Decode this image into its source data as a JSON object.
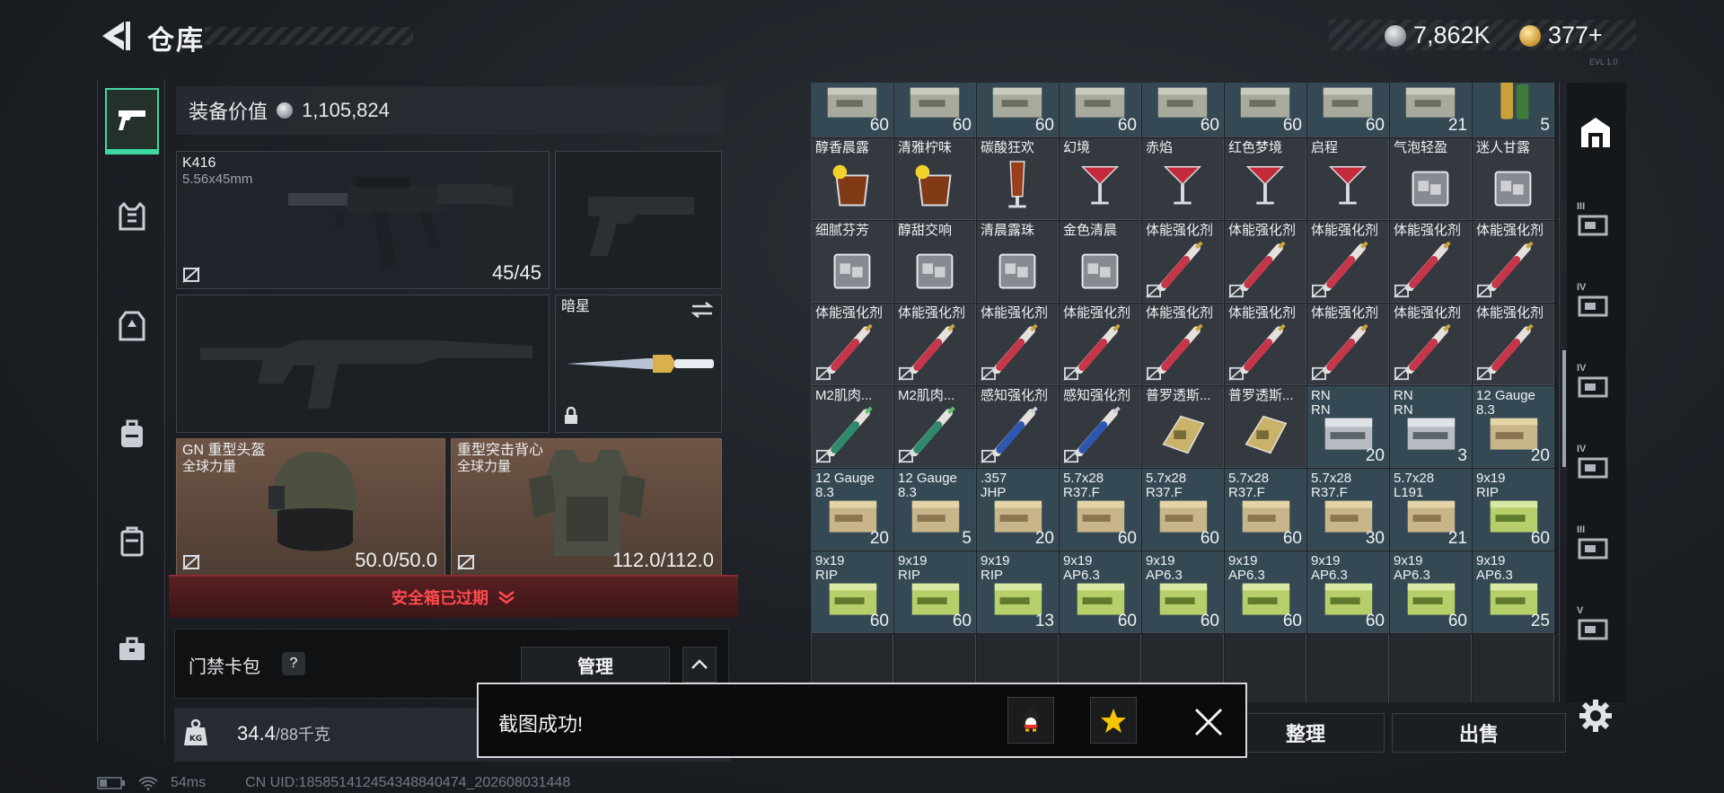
{
  "header": {
    "title": "仓库",
    "silver": "7,862K",
    "gold": "377+",
    "version": "EVL 1.0"
  },
  "loadout": {
    "equip_value_label": "装备价值",
    "equip_value": "1,105,824",
    "primary": {
      "name": "K416",
      "caliber": "5.56x45mm",
      "ammo": "45/45"
    },
    "melee": {
      "name": "暗星"
    },
    "helmet": {
      "name": "GN 重型头盔",
      "tag": "全球力量",
      "durability": "50.0/50.0"
    },
    "armor": {
      "name": "重型突击背心",
      "tag": "全球力量",
      "durability": "112.0/112.0"
    },
    "safe_box": "安全箱已过期",
    "keycard_label": "门禁卡包",
    "help": "?",
    "manage": "管理",
    "weight": "34.4",
    "weight_max": "/88千克"
  },
  "inventory": {
    "rows": [
      [
        {
          "type": "ammo-box",
          "qty": "60"
        },
        {
          "type": "ammo-box",
          "qty": "60"
        },
        {
          "type": "ammo-box",
          "qty": "60"
        },
        {
          "type": "ammo-box",
          "qty": "60"
        },
        {
          "type": "ammo-box",
          "qty": "60"
        },
        {
          "type": "ammo-box",
          "qty": "60"
        },
        {
          "type": "ammo-box",
          "qty": "60"
        },
        {
          "type": "ammo-box",
          "qty": "21"
        },
        {
          "type": "shell",
          "qty": "5"
        }
      ],
      [
        {
          "type": "drink-lemon",
          "name": "醇香晨露",
          "qty": ""
        },
        {
          "type": "drink-lemon",
          "name": "清雅柠味",
          "qty": ""
        },
        {
          "type": "drink-tall",
          "name": "碳酸狂欢",
          "qty": ""
        },
        {
          "type": "drink-martini",
          "name": "幻境",
          "qty": ""
        },
        {
          "type": "drink-martini",
          "name": "赤焰",
          "qty": ""
        },
        {
          "type": "drink-martini",
          "name": "红色梦境",
          "qty": ""
        },
        {
          "type": "drink-martini",
          "name": "启程",
          "qty": ""
        },
        {
          "type": "drink-rock",
          "name": "气泡轻盈",
          "qty": ""
        },
        {
          "type": "drink-rock",
          "name": "迷人甘露",
          "qty": ""
        }
      ],
      [
        {
          "type": "drink-rock",
          "name": "细腻芬芳",
          "qty": ""
        },
        {
          "type": "drink-rock",
          "name": "醇甜交响",
          "qty": ""
        },
        {
          "type": "drink-rock",
          "name": "清晨露珠",
          "qty": ""
        },
        {
          "type": "drink-rock",
          "name": "金色清晨",
          "qty": ""
        },
        {
          "type": "syringe-red",
          "name": "体能强化剂",
          "qty": ""
        },
        {
          "type": "syringe-red",
          "name": "体能强化剂",
          "qty": ""
        },
        {
          "type": "syringe-red",
          "name": "体能强化剂",
          "qty": ""
        },
        {
          "type": "syringe-red",
          "name": "体能强化剂",
          "qty": ""
        },
        {
          "type": "syringe-red",
          "name": "体能强化剂",
          "qty": ""
        }
      ],
      [
        {
          "type": "syringe-red",
          "name": "体能强化剂",
          "qty": ""
        },
        {
          "type": "syringe-red",
          "name": "体能强化剂",
          "qty": ""
        },
        {
          "type": "syringe-red",
          "name": "体能强化剂",
          "qty": ""
        },
        {
          "type": "syringe-red",
          "name": "体能强化剂",
          "qty": ""
        },
        {
          "type": "syringe-red",
          "name": "体能强化剂",
          "qty": ""
        },
        {
          "type": "syringe-red",
          "name": "体能强化剂",
          "qty": ""
        },
        {
          "type": "syringe-red",
          "name": "体能强化剂",
          "qty": ""
        },
        {
          "type": "syringe-red",
          "name": "体能强化剂",
          "qty": ""
        },
        {
          "type": "syringe-red",
          "name": "体能强化剂",
          "qty": ""
        }
      ],
      [
        {
          "type": "syringe-green",
          "name": "M2肌肉...",
          "qty": ""
        },
        {
          "type": "syringe-green",
          "name": "M2肌肉...",
          "qty": ""
        },
        {
          "type": "syringe-blue",
          "name": "感知强化剂",
          "qty": ""
        },
        {
          "type": "syringe-blue",
          "name": "感知强化剂",
          "qty": ""
        },
        {
          "type": "pack-gold",
          "name": "普罗透斯...",
          "qty": ""
        },
        {
          "type": "pack-gold",
          "name": "普罗透斯...",
          "qty": ""
        },
        {
          "type": "ammo-silver",
          "name": "RN",
          "name2": "RN",
          "qty": "20"
        },
        {
          "type": "ammo-silver",
          "name": "RN",
          "name2": "RN",
          "qty": "3"
        },
        {
          "type": "ammo-tan",
          "name": "12 Gauge",
          "name2": "8.3",
          "qty": "20"
        }
      ],
      [
        {
          "type": "ammo-tan",
          "name": "12 Gauge",
          "name2": "8.3",
          "qty": "20"
        },
        {
          "type": "ammo-tan",
          "name": "12 Gauge",
          "name2": "8.3",
          "qty": "5"
        },
        {
          "type": "ammo-tan",
          "name": ".357",
          "name2": "JHP",
          "qty": "20"
        },
        {
          "type": "ammo-tan",
          "name": "5.7x28",
          "name2": "R37.F",
          "qty": "60"
        },
        {
          "type": "ammo-tan",
          "name": "5.7x28",
          "name2": "R37.F",
          "qty": "60"
        },
        {
          "type": "ammo-tan",
          "name": "5.7x28",
          "name2": "R37.F",
          "qty": "60"
        },
        {
          "type": "ammo-tan",
          "name": "5.7x28",
          "name2": "R37.F",
          "qty": "30"
        },
        {
          "type": "ammo-tan",
          "name": "5.7x28",
          "name2": "L191",
          "qty": "21"
        },
        {
          "type": "ammo-green",
          "name": "9x19",
          "name2": "RIP",
          "qty": "60"
        }
      ],
      [
        {
          "type": "ammo-green",
          "name": "9x19",
          "name2": "RIP",
          "qty": "60"
        },
        {
          "type": "ammo-green",
          "name": "9x19",
          "name2": "RIP",
          "qty": "60"
        },
        {
          "type": "ammo-green",
          "name": "9x19",
          "name2": "RIP",
          "qty": "13"
        },
        {
          "type": "ammo-green",
          "name": "9x19",
          "name2": "AP6.3",
          "qty": "60"
        },
        {
          "type": "ammo-green",
          "name": "9x19",
          "name2": "AP6.3",
          "qty": "60"
        },
        {
          "type": "ammo-green",
          "name": "9x19",
          "name2": "AP6.3",
          "qty": "60"
        },
        {
          "type": "ammo-green",
          "name": "9x19",
          "name2": "AP6.3",
          "qty": "60"
        },
        {
          "type": "ammo-green",
          "name": "9x19",
          "name2": "AP6.3",
          "qty": "60"
        },
        {
          "type": "ammo-green",
          "name": "9x19",
          "name2": "AP6.3",
          "qty": "25"
        }
      ]
    ]
  },
  "actions": {
    "sort": "整理",
    "sell": "出售"
  },
  "right_rail": [
    "III",
    "IV",
    "IV",
    "IV",
    "III",
    "V"
  ],
  "toast": {
    "message": "截图成功!"
  },
  "status": {
    "ping": "54ms",
    "uid": "CN UID:185851412454348840474_202608031448"
  },
  "colors": {
    "accent": "#3fd8a0",
    "danger": "#ff4a4f",
    "ammo_cell": "#354955",
    "armor_slot": "#6f5546"
  }
}
